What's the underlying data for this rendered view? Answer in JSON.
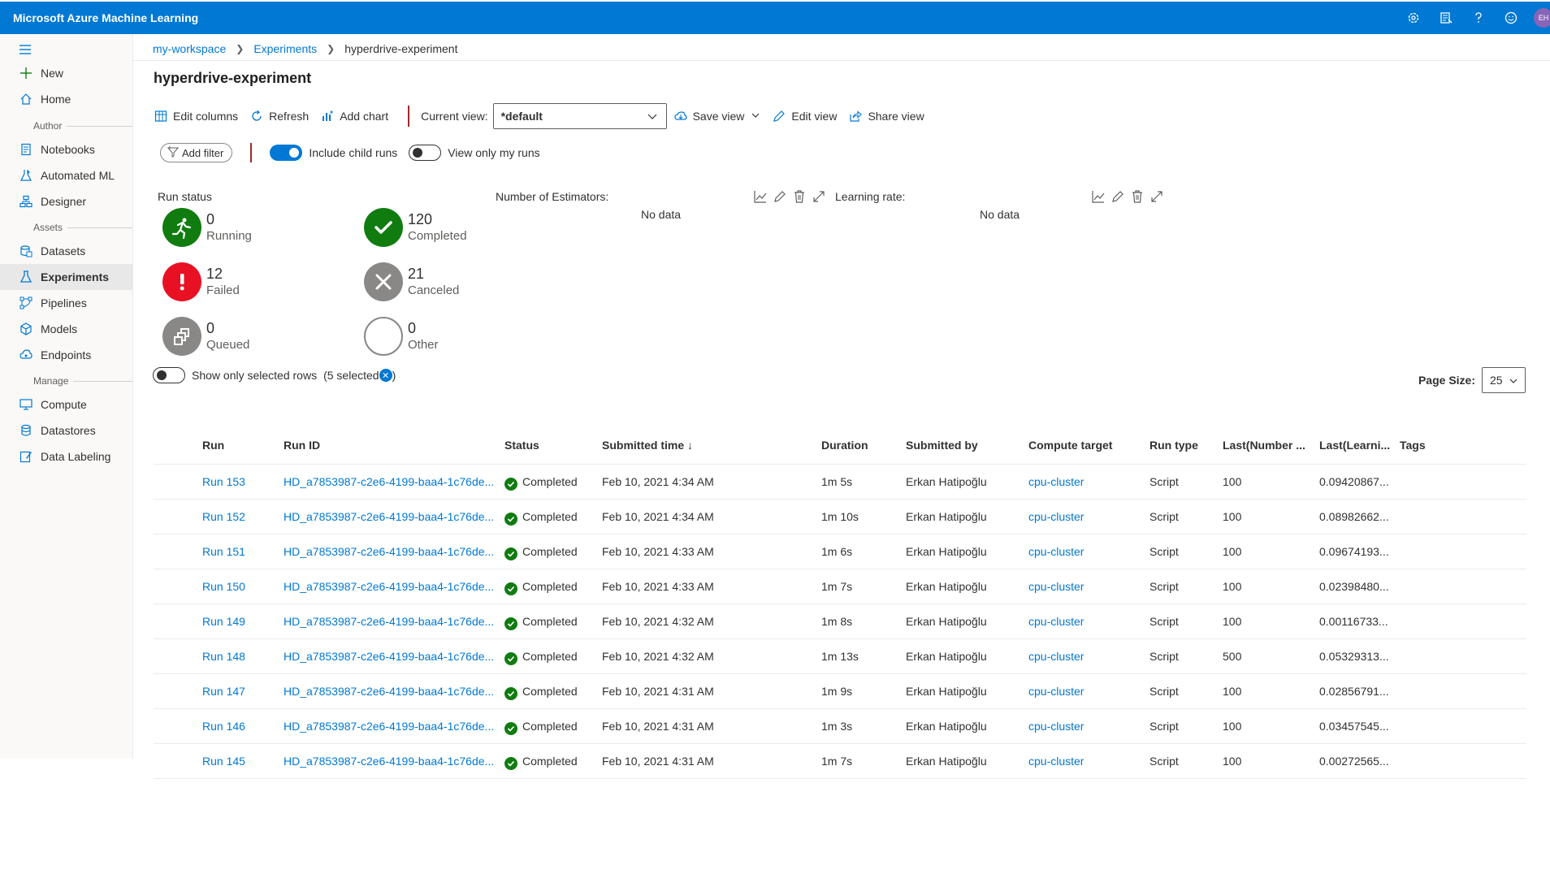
{
  "app": {
    "title": "Microsoft Azure Machine Learning",
    "avatar_initials": "EH"
  },
  "topbar_icons": [
    "gear-icon",
    "feedback-list-icon",
    "help-icon",
    "smiley-icon"
  ],
  "sidebar": {
    "top_items": [
      {
        "label": "New",
        "icon": "plus-icon"
      },
      {
        "label": "Home",
        "icon": "home-icon"
      }
    ],
    "sections": {
      "author": "Author",
      "assets": "Assets",
      "manage": "Manage"
    },
    "author_items": [
      {
        "label": "Notebooks",
        "icon": "notebook-icon"
      },
      {
        "label": "Automated ML",
        "icon": "automl-icon"
      },
      {
        "label": "Designer",
        "icon": "designer-icon"
      }
    ],
    "asset_items": [
      {
        "label": "Datasets",
        "icon": "datasets-icon"
      },
      {
        "label": "Experiments",
        "icon": "flask-icon"
      },
      {
        "label": "Pipelines",
        "icon": "pipelines-icon"
      },
      {
        "label": "Models",
        "icon": "models-icon"
      },
      {
        "label": "Endpoints",
        "icon": "endpoints-icon"
      }
    ],
    "manage_items": [
      {
        "label": "Compute",
        "icon": "compute-icon"
      },
      {
        "label": "Datastores",
        "icon": "datastores-icon"
      },
      {
        "label": "Data Labeling",
        "icon": "labeling-icon"
      }
    ]
  },
  "breadcrumb": {
    "workspace": "my-workspace",
    "experiments": "Experiments",
    "current": "hyperdrive-experiment"
  },
  "page_title": "hyperdrive-experiment",
  "toolbar": {
    "edit_columns": "Edit columns",
    "refresh": "Refresh",
    "add_chart": "Add chart",
    "current_view_label": "Current view:",
    "current_view_value": "*default",
    "save_view": "Save view",
    "edit_view": "Edit view",
    "share_view": "Share view"
  },
  "filters": {
    "add_filter": "Add filter",
    "include_child_runs": "Include child runs",
    "include_child_runs_on": true,
    "view_only_my_runs": "View only my runs",
    "view_only_my_runs_on": false
  },
  "run_status": {
    "title": "Run status",
    "running": {
      "count": "0",
      "label": "Running",
      "color": "#107c10"
    },
    "completed": {
      "count": "120",
      "label": "Completed",
      "color": "#107c10"
    },
    "failed": {
      "count": "12",
      "label": "Failed",
      "color": "#e81123"
    },
    "canceled": {
      "count": "21",
      "label": "Canceled",
      "color": "#8a8886"
    },
    "queued": {
      "count": "0",
      "label": "Queued",
      "color": "#8a8886"
    },
    "other": {
      "count": "0",
      "label": "Other",
      "color": "#8a8886"
    }
  },
  "charts": [
    {
      "title": "Number of Estimators:",
      "empty_text": "No data"
    },
    {
      "title": "Learning rate:",
      "empty_text": "No data"
    }
  ],
  "selection": {
    "show_only_selected": "Show only selected rows",
    "selected_text": "(5 selected",
    "selected_close": ")"
  },
  "page_size": {
    "label": "Page Size:",
    "value": "25"
  },
  "table": {
    "headers": {
      "run": "Run",
      "run_id": "Run ID",
      "status": "Status",
      "submitted_time": "Submitted time ↓",
      "duration": "Duration",
      "submitted_by": "Submitted by",
      "compute_target": "Compute target",
      "run_type": "Run type",
      "last_number": "Last(Number ...",
      "last_learning": "Last(Learni...",
      "tags": "Tags"
    },
    "rows": [
      {
        "run": "Run 153",
        "run_id": "HD_a7853987-c2e6-4199-baa4-1c76de...",
        "status": "Completed",
        "submitted": "Feb 10, 2021 4:34 AM",
        "duration": "1m 5s",
        "by": "Erkan Hatipoğlu",
        "compute": "cpu-cluster",
        "type": "Script",
        "estimators": "100",
        "lr": "0.09420867..."
      },
      {
        "run": "Run 152",
        "run_id": "HD_a7853987-c2e6-4199-baa4-1c76de...",
        "status": "Completed",
        "submitted": "Feb 10, 2021 4:34 AM",
        "duration": "1m 10s",
        "by": "Erkan Hatipoğlu",
        "compute": "cpu-cluster",
        "type": "Script",
        "estimators": "100",
        "lr": "0.08982662..."
      },
      {
        "run": "Run 151",
        "run_id": "HD_a7853987-c2e6-4199-baa4-1c76de...",
        "status": "Completed",
        "submitted": "Feb 10, 2021 4:33 AM",
        "duration": "1m 6s",
        "by": "Erkan Hatipoğlu",
        "compute": "cpu-cluster",
        "type": "Script",
        "estimators": "100",
        "lr": "0.09674193..."
      },
      {
        "run": "Run 150",
        "run_id": "HD_a7853987-c2e6-4199-baa4-1c76de...",
        "status": "Completed",
        "submitted": "Feb 10, 2021 4:33 AM",
        "duration": "1m 7s",
        "by": "Erkan Hatipoğlu",
        "compute": "cpu-cluster",
        "type": "Script",
        "estimators": "100",
        "lr": "0.02398480..."
      },
      {
        "run": "Run 149",
        "run_id": "HD_a7853987-c2e6-4199-baa4-1c76de...",
        "status": "Completed",
        "submitted": "Feb 10, 2021 4:32 AM",
        "duration": "1m 8s",
        "by": "Erkan Hatipoğlu",
        "compute": "cpu-cluster",
        "type": "Script",
        "estimators": "100",
        "lr": "0.00116733..."
      },
      {
        "run": "Run 148",
        "run_id": "HD_a7853987-c2e6-4199-baa4-1c76de...",
        "status": "Completed",
        "submitted": "Feb 10, 2021 4:32 AM",
        "duration": "1m 13s",
        "by": "Erkan Hatipoğlu",
        "compute": "cpu-cluster",
        "type": "Script",
        "estimators": "500",
        "lr": "0.05329313..."
      },
      {
        "run": "Run 147",
        "run_id": "HD_a7853987-c2e6-4199-baa4-1c76de...",
        "status": "Completed",
        "submitted": "Feb 10, 2021 4:31 AM",
        "duration": "1m 9s",
        "by": "Erkan Hatipoğlu",
        "compute": "cpu-cluster",
        "type": "Script",
        "estimators": "100",
        "lr": "0.02856791..."
      },
      {
        "run": "Run 146",
        "run_id": "HD_a7853987-c2e6-4199-baa4-1c76de...",
        "status": "Completed",
        "submitted": "Feb 10, 2021 4:31 AM",
        "duration": "1m 3s",
        "by": "Erkan Hatipoğlu",
        "compute": "cpu-cluster",
        "type": "Script",
        "estimators": "100",
        "lr": "0.03457545..."
      },
      {
        "run": "Run 145",
        "run_id": "HD_a7853987-c2e6-4199-baa4-1c76de...",
        "status": "Completed",
        "submitted": "Feb 10, 2021 4:31 AM",
        "duration": "1m 7s",
        "by": "Erkan Hatipoğlu",
        "compute": "cpu-cluster",
        "type": "Script",
        "estimators": "100",
        "lr": "0.00272565..."
      }
    ]
  }
}
